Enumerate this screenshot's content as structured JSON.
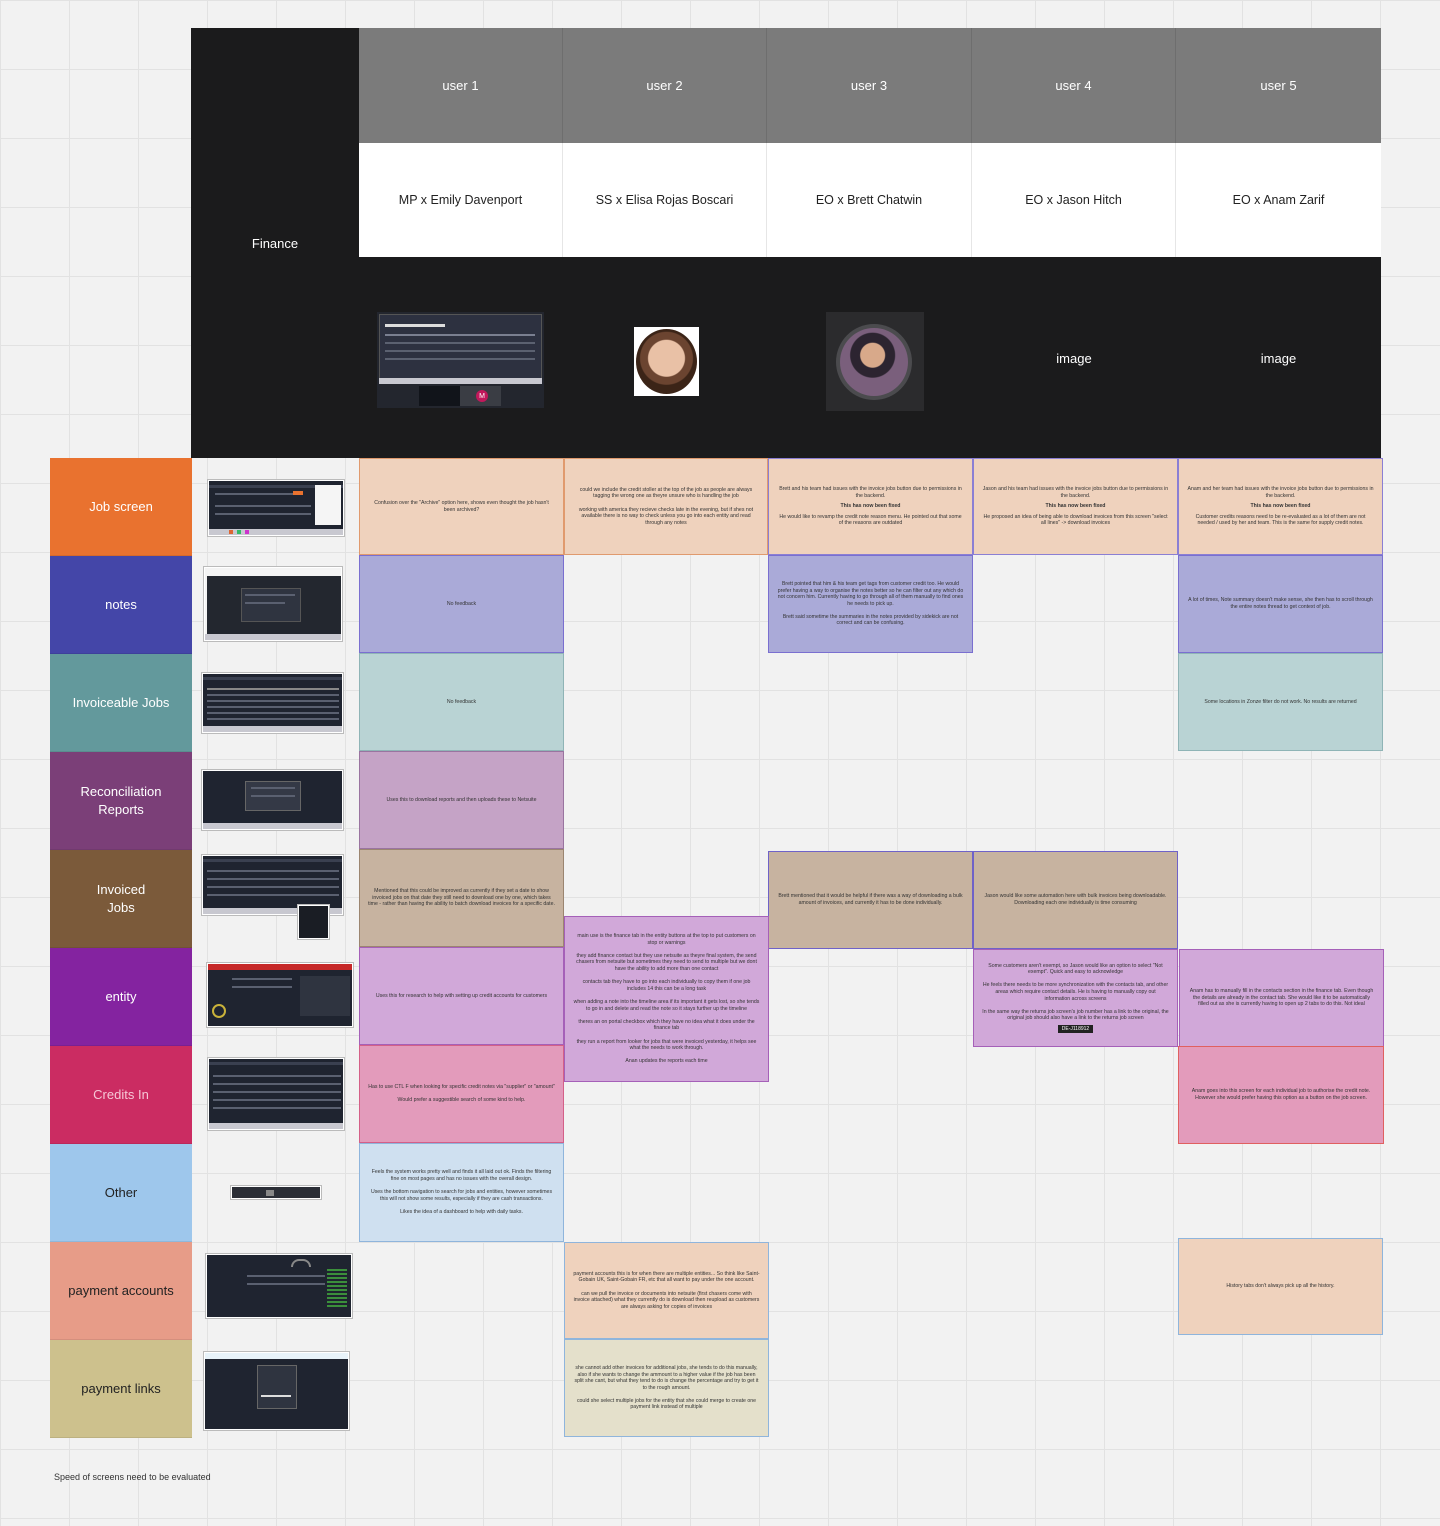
{
  "corner_label": "Finance",
  "users": [
    {
      "header": "user 1",
      "name": "MP x Emily Davenport",
      "photo": ""
    },
    {
      "header": "user 2",
      "name": "SS x Elisa Rojas Boscari",
      "photo": ""
    },
    {
      "header": "user 3",
      "name": "EO x Brett Chatwin",
      "photo": ""
    },
    {
      "header": "user 4",
      "name": "EO x Jason Hitch",
      "photo": "image"
    },
    {
      "header": "user 5",
      "name": "EO x Anam Zarif",
      "photo": "image"
    }
  ],
  "categories": [
    {
      "label": "Job screen",
      "color": "#e9722f"
    },
    {
      "label": "notes",
      "color": "#4446a8"
    },
    {
      "label": "Invoiceable Jobs",
      "color": "#63999c"
    },
    {
      "label": "Reconciliation\nReports",
      "color": "#7b3f78"
    },
    {
      "label": "Invoiced\nJobs",
      "color": "#7b5a3a"
    },
    {
      "label": "entity",
      "color": "#8423a0"
    },
    {
      "label": "Credits In",
      "color": "#cb2c62"
    },
    {
      "label": "Other",
      "color": "#9ec7ec"
    },
    {
      "label": "payment accounts",
      "color": "#e79c88"
    },
    {
      "label": "payment links",
      "color": "#cdc18d"
    }
  ],
  "cards": {
    "job_u1": "Confusion over the \"Archive\" option here, shows even thought the job hasn't been archived?",
    "job_u2": "could we include the credit stoller at the top of the job as people are always tagging the wrong one as theyre unsure who is handling the job\n\nworking with america they recieve checks late in the evening, but if shes not available there is no way to check unless you go into each entity and read through any notes",
    "job_u3_a": "Brett and his team had issues with the invoice jobs button due to permissions in the backend.",
    "job_u3_b": "This has now been fixed",
    "job_u3_c": "He would like to revamp the credit note reason menu. He pointed out that some of the reasons are outdated",
    "job_u4_a": "Jason and his team had issues with the invoice jobs button due to permissions in the backend.",
    "job_u4_b": "This has now been fixed",
    "job_u4_c": "He proposed an idea of being able to download invoices from this screen \"select all lines\" -> download invoices",
    "job_u5_a": "Anam and her team had issues with the invoice jobs button due to permissions in the backend.",
    "job_u5_b": "This has now been fixed",
    "job_u5_c": "Customer credits reasons need to be re-evaluated as a lot of them are not needed / used by her and team. This is the same for supply credit notes.",
    "notes_u1": "No feedback",
    "notes_u3": "Brett pointed that him & his team get tags from customer credit too. He would prefer having a way to organise the notes better so he can filter out any which do not concern him. Currently having to go through all of them manually to find ones he needs to pick up.\n\nBrett said sometime the summaries in the notes provided by sidekick are not correct and can be confusing.",
    "notes_u5": "A lot of times, Note summary doesn't make sense, she then has to scroll through the entire notes thread to get context of job.",
    "inv_u1": "No feedback",
    "inv_u5": "Some locations in Zonze filter do not work. No results are returned",
    "recon_u1": "Uses this to download reports and then uploads these to Netsuite",
    "invoiced_u1": "Mentioned that this could be improved as currently if they set a date to show invoiced jobs on that date they still need to download one by one, which takes time - rather than having the ability to batch download invoices for a specific date.",
    "invoiced_u3": "Brett mentioned that it would be helpful if there was a way of downloading a bulk amount of invoices, and currently it has to be done individually.",
    "invoiced_u4": "Jason would like some automation here with bulk invoices being downloadable. Downloading each one individually is time consuming",
    "entity_u1": "Uses this for research to help with setting up credit accounts for customers",
    "entity_u2": "main use is the finance tab in the entity buttons at the top to put customers on stop or warnings\n\nthey add finance contact but they use netsuite as theyre final system, the send chasers from netsuite but sometimes they need to send to multiple but we dont have the ability to add more than one contact\n\ncontacts tab they have to go into each individually to copy them if one job includes 14 this can be a long task\n\nwhen adding a note into the timeline area if its important it gets lost, so she tends to go in and delete and read the note so it stays further up the timeline\n\ntheres an on portal checkbox which they have no idea what it does under the finance tab\n\nthey run a report from looker for jobs that were invoiced yesterday, it helps see what the needs to work through.\n\nAnan updates the reports each time",
    "entity_u4": "Some customers aren't exempt, so Jason would like an option to select \"Not exempt\". Quick and easy to acknowledge\n\nHe feels there needs to be more synchronization with the contacts tab, and other areas which require contact details. He is having to manually copy out information across screens\n\nIn the same way the returns job screen's job number has a link to the original, the original job should also have a link to the returns job screen",
    "entity_u4_badge": "DE-J118912",
    "entity_u5": "Anam has to manually fill in the contacts section in the finance tab. Even though the details are already in the contact tab. She would like it to be automatically filled out as she is currently having to open up 2 tabs to do this. Not ideal",
    "credits_u1": "Has to use CTL F when looking for specific credit notes via \"supplier\" or \"amount\"\n\nWould prefer a suggestible search of some kind to help.",
    "credits_u5": "Anam goes into this screen for each individual job to authorise the credit note. However she would prefer having this option as a button on the job screen.",
    "other_u1": "Feels the system works pretty well and finds it all laid out ok. Finds the filtering fine on most pages and has no issues with the overall design.\n\nUses the bottom navigation to search for jobs and entities, however sometimes this will not show some results, especially if they are cash transactions.\n\nLikes the idea of a dashboard to help with daily tasks.",
    "payacc_u2": "payment accounts this is for when there are multiple entities... So think like Saint-Gobain UK, Saint-Gobain FR, etc that all want to pay under the one account.\n\ncan we pull the invoice or documents into netsuite (first chasers come with invoice attached) what they currently do is download then reupload as customers are always asking for copies of invoices",
    "payacc_u5": "History tabs don't always pick up all the history.",
    "paylinks_u2": "she cannot add other invoices for additional jobs, she tends to do this manually, also if she wants to change the ammount to a higher value if the job has been split she cant, but what they tend to do is change the percentage and try to get it to the rough amount.\n\ncould she select multiple jobs for the entity that she could merge to create one payment link instead of multiple"
  },
  "footnote": "Speed of screens need to be evaluated"
}
